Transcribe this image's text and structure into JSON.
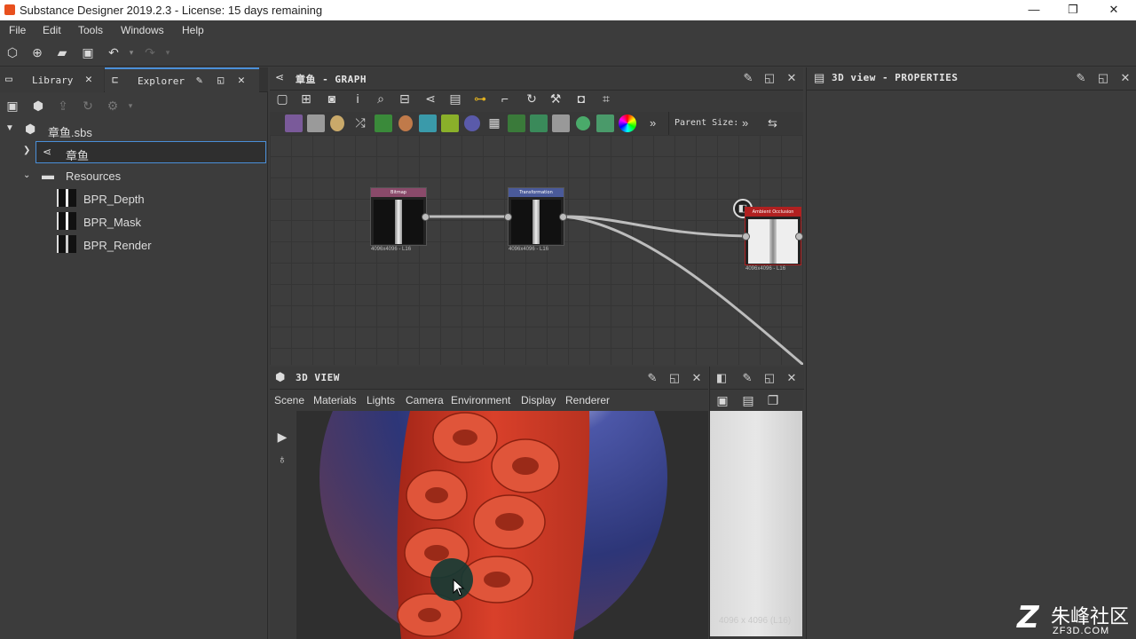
{
  "window": {
    "title": "Substance Designer 2019.2.3 - License: 15 days remaining"
  },
  "menu": [
    "File",
    "Edit",
    "Tools",
    "Windows",
    "Help"
  ],
  "left_panel": {
    "tabs": {
      "library": "Library",
      "explorer": "Explorer"
    },
    "tree": {
      "package": "章鱼.sbs",
      "graph": "章鱼",
      "folder": "Resources",
      "resources": [
        "BPR_Depth",
        "BPR_Mask",
        "BPR_Render"
      ]
    }
  },
  "graph_panel": {
    "title": "章鱼 - GRAPH",
    "parent_size_label": "Parent Size:",
    "nodes": [
      {
        "title": "Bitmap",
        "info": "4096x4096 - L16",
        "color": "#8a4a6a"
      },
      {
        "title": "Transformation",
        "info": "4096x4096 - L16",
        "color": "#4a5a9a"
      },
      {
        "title": "Ambient Occlusion",
        "info": "4096x4096 - L16",
        "color": "#b02020"
      }
    ]
  },
  "props_panel": {
    "title": "3D view - PROPERTIES"
  },
  "view3d": {
    "title": "3D VIEW",
    "menu": [
      "Scene",
      "Materials",
      "Lights",
      "Camera",
      "Environment",
      "Display",
      "Renderer"
    ]
  },
  "view2d": {
    "resolution": "4096 x 4096 (L16)"
  },
  "watermark": {
    "brand": "朱峰社区",
    "url": "ZF3D.COM"
  },
  "icons": {
    "app": "substance-designer-icon",
    "minimize": "minimize-icon",
    "restore": "restore-icon",
    "close": "close-icon"
  }
}
